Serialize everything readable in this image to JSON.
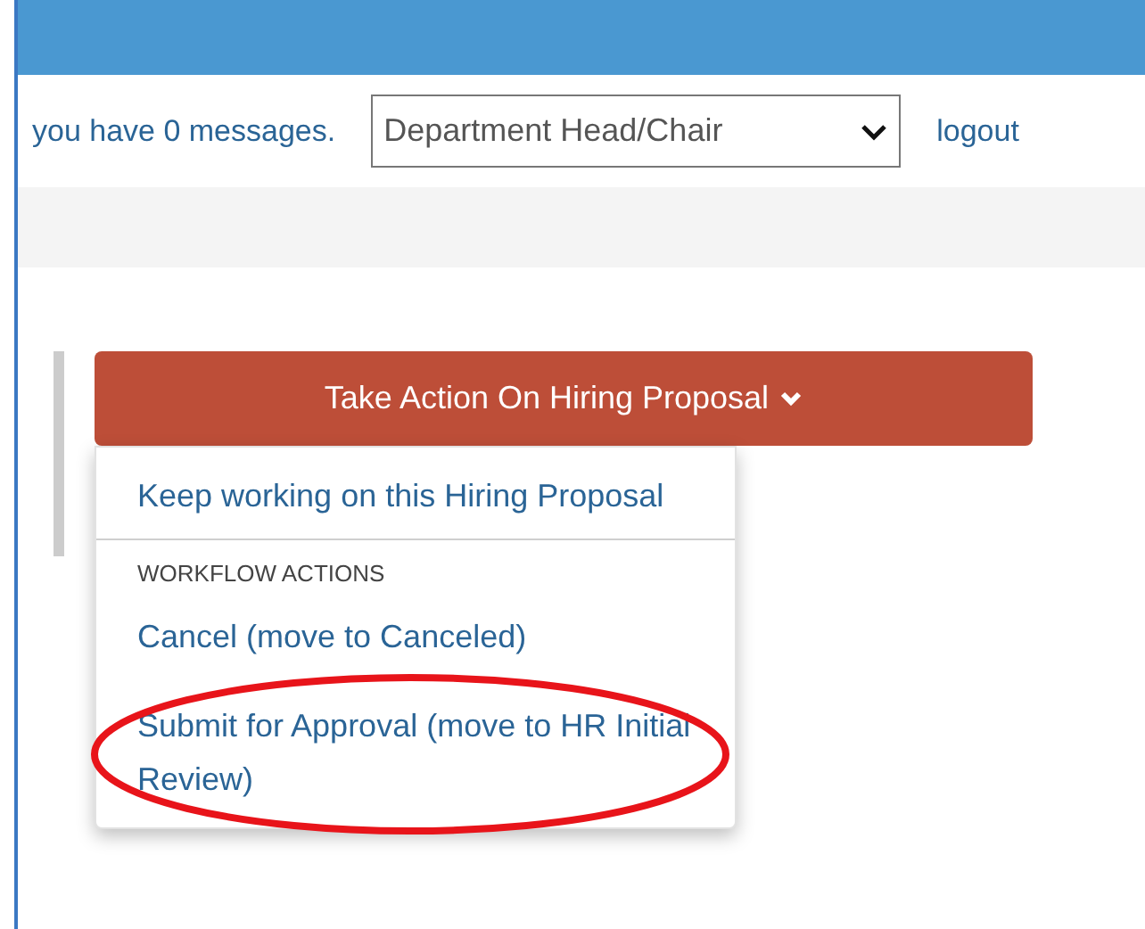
{
  "top_bar": {
    "messages": "you have 0 messages.",
    "role_select": {
      "value": "Department Head/Chair"
    },
    "logout": "logout"
  },
  "action_button": {
    "label": "Take Action On Hiring Proposal"
  },
  "menu": [
    {
      "kind": "item",
      "label": "Keep working on this Hiring Proposal",
      "highlighted": false
    },
    {
      "kind": "divider"
    },
    {
      "kind": "header",
      "label": "WORKFLOW ACTIONS"
    },
    {
      "kind": "item",
      "label": "Cancel (move to Canceled)",
      "highlighted": false
    },
    {
      "kind": "item",
      "label": "Submit for Approval (move to HR Initial Review)",
      "highlighted": true
    }
  ]
}
